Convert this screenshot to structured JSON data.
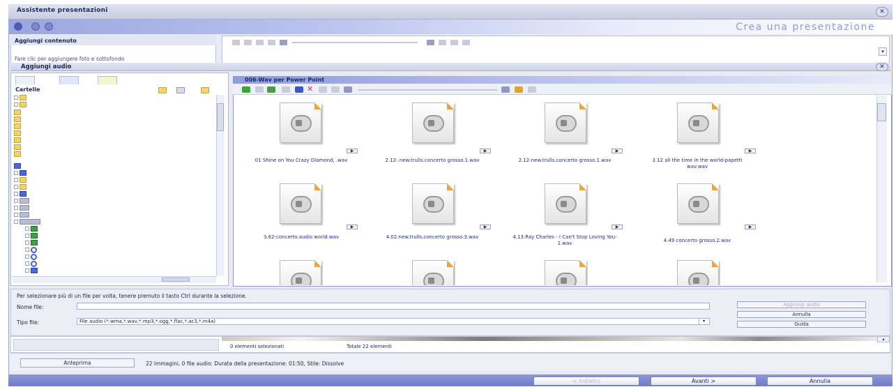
{
  "window": {
    "title": "Assistente presentazioni",
    "close_symbol": "✕"
  },
  "wizard": {
    "heading": "Crea una presentazione",
    "steps": 3
  },
  "content_section": {
    "title": "Aggiungi contenuto",
    "hint": "Fare clic per aggiungere foto e sottofondo"
  },
  "audio_section": {
    "title": "Aggiungi audio",
    "close_symbol": "✕"
  },
  "folders": {
    "label": "Cartelle"
  },
  "file_browser": {
    "folder_name": "006-Wav per Power Point",
    "files": [
      {
        "name": "01 Shine on You Crazy Diamond, .wav"
      },
      {
        "name": "2.12-.new.trulls.concerto grosso.1.wav"
      },
      {
        "name": "2.12-new.trulls.concerto grosso.1.wav"
      },
      {
        "name": "3.12 all the time in the world-papetti wav.wav"
      },
      {
        "name": "3.62-concerto.audio world.wav"
      },
      {
        "name": "4.02.new.trulls.concerto grosso.3.wav"
      },
      {
        "name": "4.13.Ray Charles - I Can't Stop Loving You-1.wav"
      },
      {
        "name": "4.49 concerto grosso.2.wav"
      },
      {
        "name": ""
      },
      {
        "name": ""
      },
      {
        "name": ""
      },
      {
        "name": ""
      }
    ],
    "play_symbol": "▶"
  },
  "dialog": {
    "hint": "Per selezionare più di un file per volta, tenere premuto il tasto Ctrl durante la selezione.",
    "file_name_label": "Nome file:",
    "file_name_value": "",
    "file_type_label": "Tipo file:",
    "file_type_value": "File audio (*.wma,*.wav,*.mp3,*.ogg,*.flac,*.ac3,*.m4a)",
    "add_audio_button": "Aggiungi audio",
    "cancel_button": "Annulla",
    "help_button": "Guida"
  },
  "status": {
    "selected": "0 elementi selezionati",
    "total": "Totale 22 elementi"
  },
  "summary": {
    "preview_button": "Anteprima",
    "text": "22 immagini,  0 file audio: Durata della presentazione: 01:50,  Stile: Dissolve"
  },
  "footer": {
    "back_button": "< Indietro",
    "next_button": "Avanti >",
    "cancel_button": "Annulla"
  }
}
